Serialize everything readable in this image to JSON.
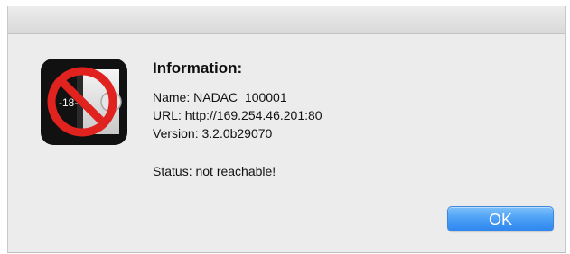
{
  "dialog": {
    "heading": "Information:",
    "name_line": "Name: NADAC_100001",
    "url_line": "URL: http://169.254.46.201:80",
    "version_line": "Version: 3.2.0b29070",
    "status_line": "Status: not reachable!",
    "ok_label": "OK",
    "icon": {
      "name": "device-unreachable-icon",
      "temperature_text": "-18-"
    }
  },
  "colors": {
    "dialog_bg": "#ececec",
    "button_blue": "#4ea2f6",
    "prohibition_red": "#e0231e",
    "icon_dark": "#111111"
  }
}
